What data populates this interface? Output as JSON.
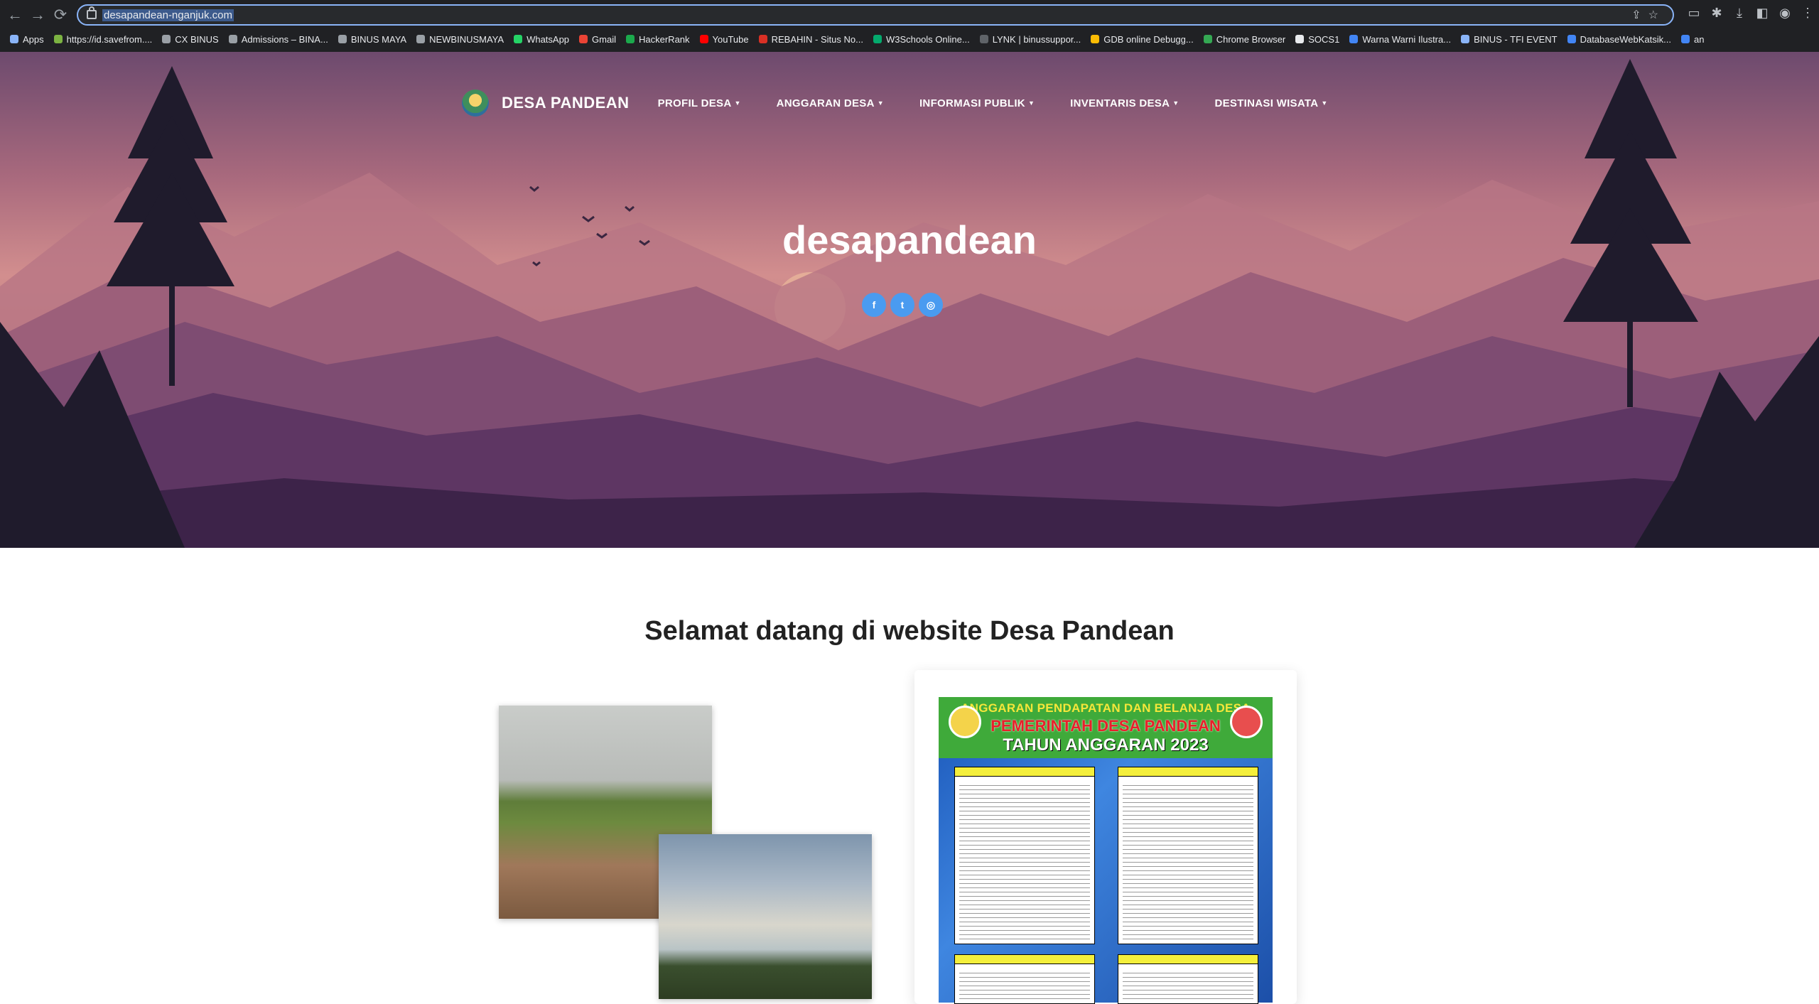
{
  "browser": {
    "url": "desapandean-nganjuk.com",
    "bookmarks": [
      {
        "label": "Apps",
        "color": "#8ab4f8"
      },
      {
        "label": "https://id.savefrom....",
        "color": "#7cb342"
      },
      {
        "label": "CX BINUS",
        "color": "#9aa0a6"
      },
      {
        "label": "Admissions – BINA...",
        "color": "#9aa0a6"
      },
      {
        "label": "BINUS MAYA",
        "color": "#9aa0a6"
      },
      {
        "label": "NEWBINUSMAYA",
        "color": "#9aa0a6"
      },
      {
        "label": "WhatsApp",
        "color": "#25d366"
      },
      {
        "label": "Gmail",
        "color": "#ea4335"
      },
      {
        "label": "HackerRank",
        "color": "#1ba94c"
      },
      {
        "label": "YouTube",
        "color": "#ff0000"
      },
      {
        "label": "REBAHIN - Situs No...",
        "color": "#d93025"
      },
      {
        "label": "W3Schools Online...",
        "color": "#04aa6d"
      },
      {
        "label": "LYNK | binussuppor...",
        "color": "#5f6368"
      },
      {
        "label": "GDB online Debugg...",
        "color": "#fbbc04"
      },
      {
        "label": "Chrome Browser",
        "color": "#34a853"
      },
      {
        "label": "SOCS1",
        "color": "#e8eaed"
      },
      {
        "label": "Warna Warni Ilustra...",
        "color": "#4285f4"
      },
      {
        "label": "BINUS - TFI EVENT",
        "color": "#8ab4f8"
      },
      {
        "label": "DatabaseWebKatsik...",
        "color": "#4285f4"
      },
      {
        "label": "an",
        "color": "#4285f4"
      }
    ]
  },
  "site": {
    "brand": "DESA PANDEAN",
    "menu": [
      {
        "label": "PROFIL DESA"
      },
      {
        "label": "ANGGARAN DESA"
      },
      {
        "label": "INFORMASI PUBLIK"
      },
      {
        "label": "INVENTARIS DESA"
      },
      {
        "label": "DESTINASI WISATA"
      }
    ],
    "hero_title": "desapandean",
    "socials": [
      {
        "icon": "facebook-icon",
        "glyph": "f"
      },
      {
        "icon": "twitter-icon",
        "glyph": "t"
      },
      {
        "icon": "instagram-icon",
        "glyph": "◎"
      }
    ],
    "welcome": "Selamat datang di website Desa Pandean",
    "poster": {
      "line1": "ANGGARAN PENDAPATAN DAN BELANJA DESA",
      "line2": "PEMERINTAH DESA PANDEAN",
      "line3": "TAHUN ANGGARAN 2023"
    }
  }
}
